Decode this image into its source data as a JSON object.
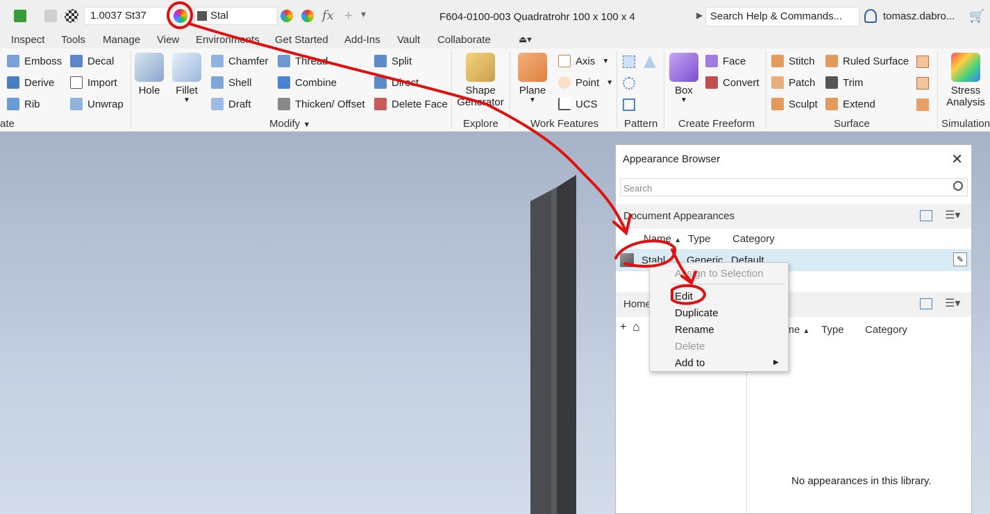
{
  "quick_access": {
    "material": "1.0037 St37",
    "appearance": "Stal",
    "document_title": "F604-0100-003 Quadratrohr 100 x 100 x 4",
    "search_placeholder": "Search Help & Commands...",
    "user": "tomasz.dabro...",
    "fx": "fx"
  },
  "tabs": [
    "Inspect",
    "Tools",
    "Manage",
    "View",
    "Environments",
    "Get Started",
    "Add-Ins",
    "Vault",
    "Collaborate"
  ],
  "ribbon": {
    "create_frag": "ate",
    "create": [
      "Emboss",
      "Decal",
      "Derive",
      "Import",
      "Rib",
      "Unwrap"
    ],
    "hole": "Hole",
    "fillet": "Fillet",
    "modify": [
      "Chamfer",
      "Thread",
      "Split",
      "Shell",
      "Combine",
      "Direct",
      "Draft",
      "Thicken/ Offset",
      "Delete Face"
    ],
    "modify_label": "Modify",
    "shape_generator": [
      "Shape",
      "Generator"
    ],
    "explore_label": "Explore",
    "plane": "Plane",
    "work": [
      "Axis",
      "Point",
      "UCS"
    ],
    "work_label": "Work Features",
    "pattern_label": "Pattern",
    "box": "Box",
    "freeform": [
      "Face",
      "Convert"
    ],
    "freeform_label": "Create Freeform",
    "surface": [
      "Stitch",
      "Ruled Surface",
      "Patch",
      "Trim",
      "Sculpt",
      "Extend"
    ],
    "surface_label": "Surface",
    "stress": [
      "Stress",
      "Analysis"
    ],
    "simulation_label": "Simulation"
  },
  "appearance_browser": {
    "title": "Appearance Browser",
    "search_placeholder": "Search",
    "document_appearances": "Document Appearances",
    "col_name": "Name",
    "col_type": "Type",
    "col_category": "Category",
    "row": {
      "name": "Stahl",
      "type": "Generic",
      "category": "Default"
    },
    "home": "Home",
    "lib_col_name": "ame",
    "empty_msg": "No appearances in this library."
  },
  "context_menu": {
    "assign": "Assign to Selection",
    "edit": "Edit",
    "duplicate": "Duplicate",
    "rename": "Rename",
    "delete": "Delete",
    "add_to": "Add to"
  },
  "colors": {
    "annotation": "#e01010",
    "viewport_top": "#a6b2c6",
    "row_highlight": "#d9ecf6"
  }
}
